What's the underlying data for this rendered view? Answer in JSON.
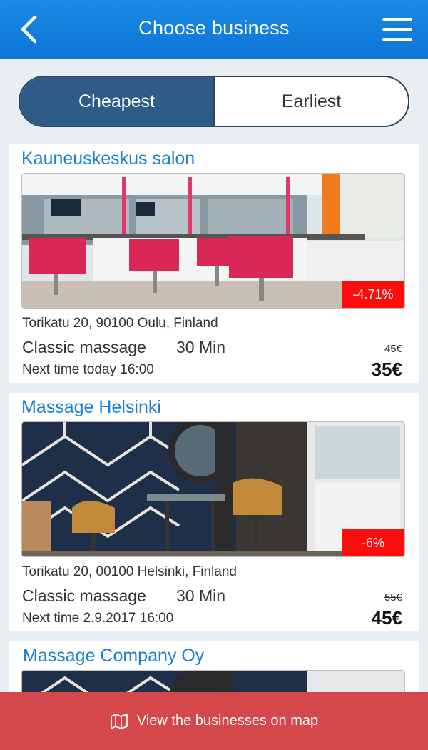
{
  "header": {
    "title": "Choose business"
  },
  "sort": {
    "cheapest_label": "Cheapest",
    "earliest_label": "Earliest",
    "active": "cheapest"
  },
  "businesses": [
    {
      "name": "Kauneuskeskus salon",
      "discount": "-4.71%",
      "address": "Torikatu 20, 90100 Oulu, Finland",
      "service": "Classic massage",
      "duration": "30 Min",
      "old_price": "45€",
      "next_time": "Next time today 16:00",
      "price": "35€"
    },
    {
      "name": "Massage Helsinki",
      "discount": "-6%",
      "address": "Torikatu 20, 00100 Helsinki, Finland",
      "service": "Classic massage",
      "duration": "30 Min",
      "old_price": "55€",
      "next_time": "Next time 2.9.2017 16:00",
      "price": "45€"
    },
    {
      "name": "Massage Company Oy"
    }
  ],
  "map_button": {
    "label": "View the businesses on map",
    "icon": "map-icon"
  },
  "colors": {
    "header": "#1a8ae6",
    "segment_active": "#2e5b87",
    "title_link": "#1b7fd6",
    "discount_badge": "#ff0d0d",
    "map_bar": "#d4474a"
  }
}
